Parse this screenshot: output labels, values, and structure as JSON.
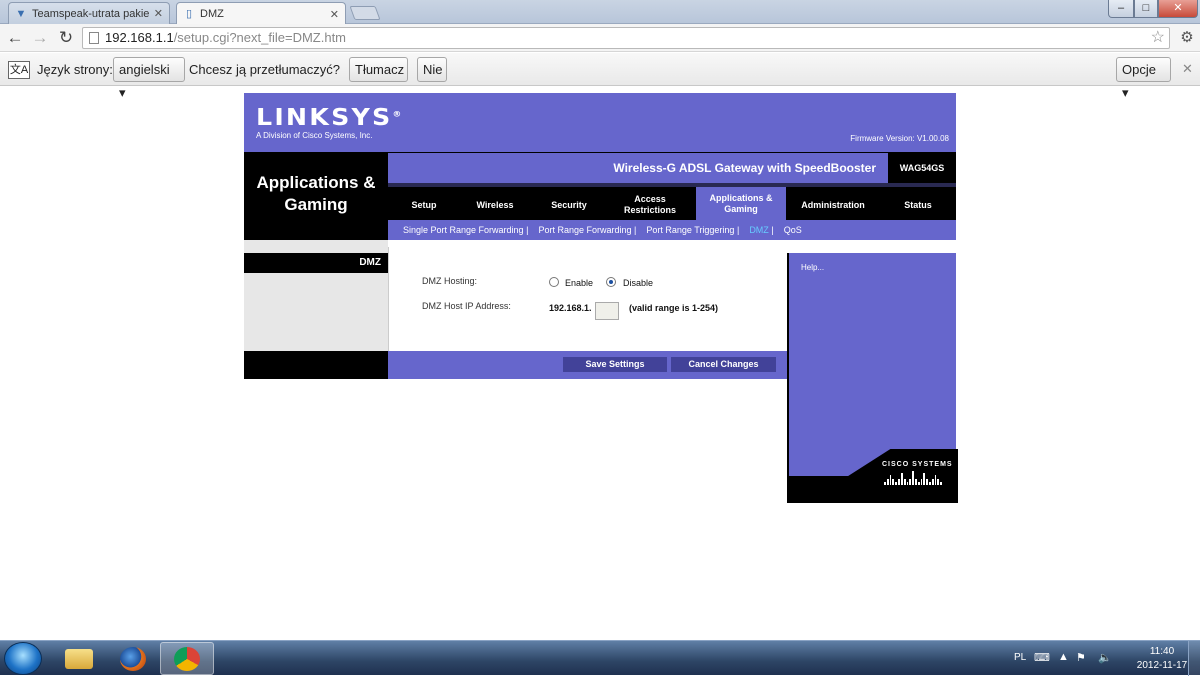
{
  "browser": {
    "tabs": [
      {
        "title": "Teamspeak-utrata pakietów",
        "active": false
      },
      {
        "title": "DMZ",
        "active": true
      }
    ],
    "url": {
      "host": "192.168.1.1",
      "path": "/setup.cgi?next_file=DMZ.htm"
    },
    "window_controls": {
      "minimize": "–",
      "maximize": "□",
      "close": "✕"
    }
  },
  "translate_bar": {
    "page_lang_label": "Język strony:",
    "page_lang_value": "angielski ▾",
    "question": "Chcesz ją przetłumaczyć?",
    "translate_button": "Tłumacz",
    "no_button": "Nie",
    "options_button": "Opcje ▾",
    "close": "✕"
  },
  "router": {
    "brand": "LINKSYS",
    "brand_reg": "®",
    "brand_sub": "A Division of Cisco Systems, Inc.",
    "firmware": "Firmware Version: V1.00.08",
    "section_title_1": "Applications &",
    "section_title_2": "Gaming",
    "product_name": "Wireless-G ADSL Gateway with SpeedBooster",
    "model": "WAG54GS",
    "tabs": [
      {
        "label": "Setup"
      },
      {
        "label": "Wireless"
      },
      {
        "label": "Security"
      },
      {
        "label": "Access Restrictions"
      },
      {
        "label": "Applications & Gaming"
      },
      {
        "label": "Administration"
      },
      {
        "label": "Status"
      }
    ],
    "subnav": {
      "item1": "Single Port Range Forwarding",
      "item2": "Port Range Forwarding",
      "item3": "Port Range Triggering",
      "item4": "DMZ",
      "item5": "QoS",
      "sep": "|"
    },
    "left_label": "DMZ",
    "form": {
      "hosting_label": "DMZ Hosting:",
      "enable_label": "Enable",
      "disable_label": "Disable",
      "selected": "Disable",
      "host_ip_label": "DMZ Host IP Address:",
      "ip_prefix": "192.168.1.",
      "ip_value": "",
      "range_note": "(valid range is 1-254)"
    },
    "save_button": "Save Settings",
    "cancel_button": "Cancel Changes",
    "help_link": "Help...",
    "cisco_text": "CISCO SYSTEMS"
  },
  "taskbar": {
    "lang": "PL",
    "clock_time": "11:40",
    "clock_date": "2012-11-17"
  }
}
